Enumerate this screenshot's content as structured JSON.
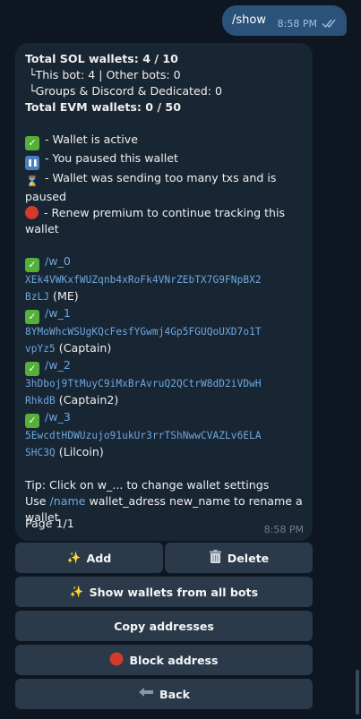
{
  "outgoing": {
    "text": "/show",
    "time": "8:58 PM"
  },
  "incoming": {
    "time": "8:58 PM",
    "page": "Page 1/1",
    "header": {
      "total_sol": "Total SOL wallets: 4 / 10",
      "this_bot": " └This bot: 4 | Other bots: 0",
      "groups": " └Groups & Discord & Dedicated: 0",
      "total_evm": "Total EVM wallets: 0 / 50"
    },
    "legend": {
      "active": " - Wallet is active",
      "paused": " - You paused this wallet",
      "too_many_1": " - Wallet was sending too many txs and is",
      "too_many_2": "paused",
      "renew_1": " - Renew premium to continue tracking this",
      "renew_2": "wallet"
    },
    "wallets": [
      {
        "cmd": "/w_0",
        "addr1": "XEk4VWKxfWUZqnb4xRoFk4VNrZEbTX7G9FNpBX2",
        "addr2": "BzLJ",
        "label": " (ME)"
      },
      {
        "cmd": "/w_1",
        "addr1": "8YMoWhcWSUgKQcFesfYGwmj4Gp5FGUQoUXD7o1T",
        "addr2": "vpYz5",
        "label": " (Captain)"
      },
      {
        "cmd": "/w_2",
        "addr1": "3hDboj9TtMuyC9iMxBrAvruQ2QCtrW8dD2iVDwH",
        "addr2": "RhkdB",
        "label": " (Captain2)"
      },
      {
        "cmd": "/w_3",
        "addr1": "5EwcdtHDWUzujo91ukUr3rrTShNwwCVAZLv6ELA",
        "addr2": "SHC3Q",
        "label": " (Lilcoin)"
      }
    ],
    "tip": {
      "line1": "Tip: Click on w_... to change wallet settings",
      "use": "Use ",
      "name_cmd": "/name",
      "rest": " wallet_adress new_name to rename a",
      "line3": "wallet"
    }
  },
  "keyboard": {
    "add": "Add",
    "delete": "Delete",
    "show_all": "Show wallets from all bots",
    "copy": "Copy addresses",
    "block": "Block address",
    "back": "Back"
  },
  "colors": {
    "background": "#0e1621",
    "outgoing_bubble": "#2b5278",
    "incoming_bubble": "#182533",
    "button": "#2a3a4b",
    "link": "#6fa8dc"
  },
  "icons": {
    "active": "check-mark-icon",
    "paused": "pause-icon",
    "too_many": "hourglass-icon",
    "renew": "red-circle-icon",
    "add": "sparkles-icon",
    "delete": "wastebasket-icon",
    "block": "red-circle-icon",
    "back": "back-arrow-icon"
  }
}
